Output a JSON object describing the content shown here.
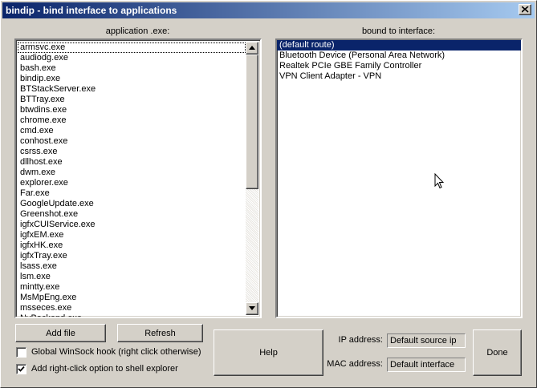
{
  "window": {
    "title": "bindip - bind interface to applications"
  },
  "app_list": {
    "label": "application .exe:",
    "items": [
      "armsvc.exe",
      "audiodg.exe",
      "bash.exe",
      "bindip.exe",
      "BTStackServer.exe",
      "BTTray.exe",
      "btwdins.exe",
      "chrome.exe",
      "cmd.exe",
      "conhost.exe",
      "csrss.exe",
      "dllhost.exe",
      "dwm.exe",
      "explorer.exe",
      "Far.exe",
      "GoogleUpdate.exe",
      "Greenshot.exe",
      "igfxCUIService.exe",
      "igfxEM.exe",
      "igfxHK.exe",
      "igfxTray.exe",
      "lsass.exe",
      "lsm.exe",
      "mintty.exe",
      "MsMpEng.exe",
      "msseces.exe",
      "NvBackend.exe"
    ]
  },
  "iface_list": {
    "label": "bound to interface:",
    "items": [
      "(default route)",
      "Bluetooth Device (Personal Area Network)",
      "Realtek PCIe GBE Family Controller",
      "VPN Client Adapter - VPN"
    ],
    "selected_index": 0
  },
  "buttons": {
    "add_file": "Add file",
    "refresh": "Refresh",
    "help": "Help",
    "done": "Done"
  },
  "options": {
    "global_hook": {
      "label": "Global WinSock hook (right click otherwise)",
      "checked": false
    },
    "shell_option": {
      "label": "Add right-click option to shell explorer",
      "checked": true
    }
  },
  "fields": {
    "ip": {
      "label": "IP address:",
      "value": "Default source ip"
    },
    "mac": {
      "label": "MAC address:",
      "value": "Default interface"
    }
  },
  "icons": {
    "close": "close-icon",
    "scroll_up": "arrow-up-icon",
    "scroll_down": "arrow-down-icon",
    "check": "check-icon",
    "cursor": "mouse-pointer-icon"
  }
}
